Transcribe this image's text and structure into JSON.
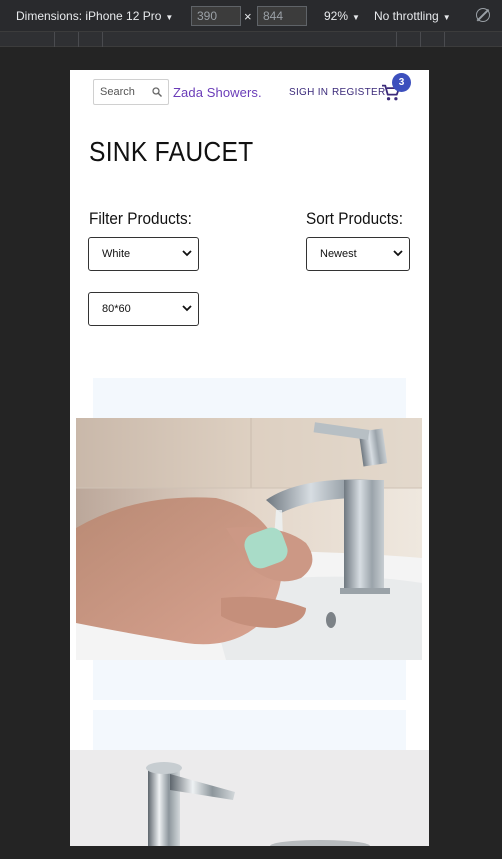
{
  "devtools": {
    "dimensions_label": "Dimensions: iPhone 12 Pro",
    "width": "390",
    "height": "844",
    "times": "×",
    "zoom": "92%",
    "throttling": "No throttling"
  },
  "header": {
    "search_placeholder": "Search",
    "brand": "Zada Showers.",
    "sign_in": "SIGH IN",
    "register": "REGISTER",
    "cart_count": "3"
  },
  "page": {
    "title": "SINK FAUCET",
    "filter_label": "Filter Products:",
    "sort_label": "Sort Products:",
    "filter_color": "White",
    "filter_size": "80*60",
    "sort_value": "Newest"
  },
  "colors": {
    "brand": "#6a3cb8",
    "nav": "#3b2a7a",
    "badge": "#3c4fbd",
    "card_bg": "#f3f8fd"
  }
}
